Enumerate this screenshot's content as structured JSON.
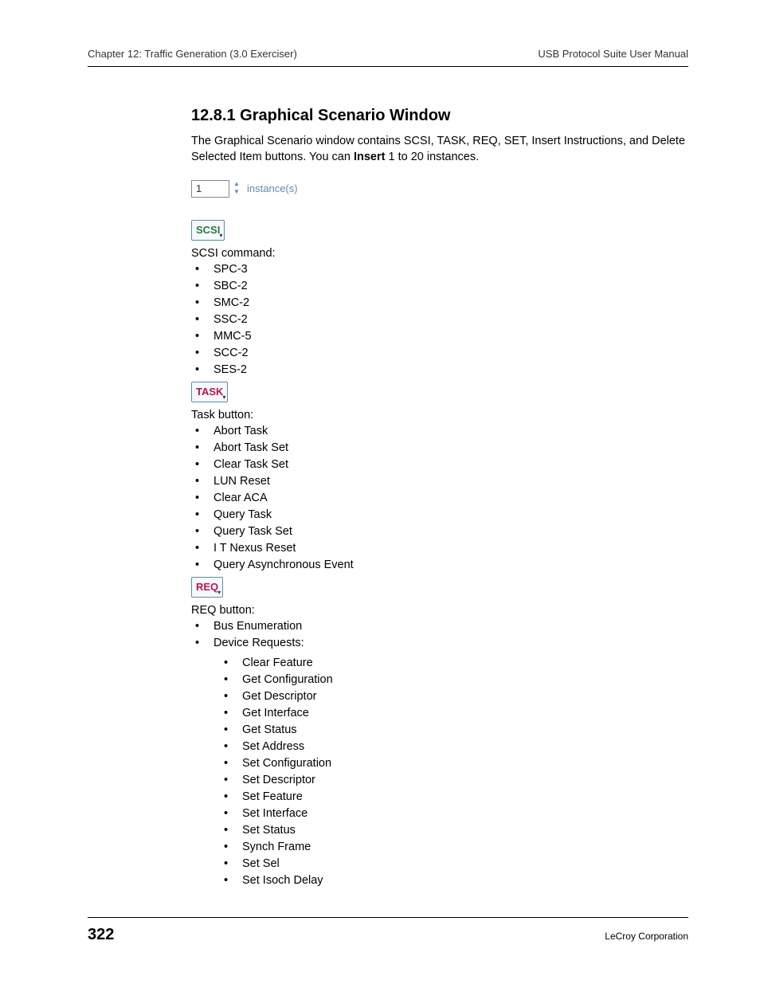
{
  "header": {
    "left": "Chapter 12: Traffic Generation (3.0 Exerciser)",
    "right": "USB Protocol Suite User Manual"
  },
  "section_title": "12.8.1 Graphical Scenario Window",
  "intro_part1": "The Graphical Scenario window contains SCSI, TASK, REQ, SET, Insert Instructions, and Delete Selected Item buttons. You can ",
  "intro_bold": "Insert",
  "intro_part2": " 1 to 20 instances.",
  "instance": {
    "value": "1",
    "label": "instance(s)"
  },
  "scsi": {
    "btn": "SCSI",
    "label": "SCSI command:",
    "items": [
      "SPC-3",
      "SBC-2",
      "SMC-2",
      "SSC-2",
      "MMC-5",
      "SCC-2",
      "SES-2"
    ]
  },
  "task": {
    "btn": "TASK",
    "label": "Task button:",
    "items": [
      "Abort Task",
      "Abort Task Set",
      "Clear Task Set",
      "LUN Reset",
      "Clear ACA",
      "Query Task",
      "Query Task Set",
      "I T Nexus Reset",
      "Query Asynchronous Event"
    ]
  },
  "req": {
    "btn": "REQ",
    "label": "REQ button:",
    "items": [
      "Bus Enumeration",
      "Device Requests:"
    ],
    "sub_items": [
      "Clear Feature",
      "Get Configuration",
      "Get Descriptor",
      "Get Interface",
      "Get Status",
      "Set Address",
      "Set Configuration",
      "Set Descriptor",
      "Set Feature",
      "Set Interface",
      "Set Status",
      "Synch Frame",
      "Set Sel",
      "Set Isoch Delay"
    ]
  },
  "footer": {
    "page": "322",
    "corp": "LeCroy Corporation"
  }
}
